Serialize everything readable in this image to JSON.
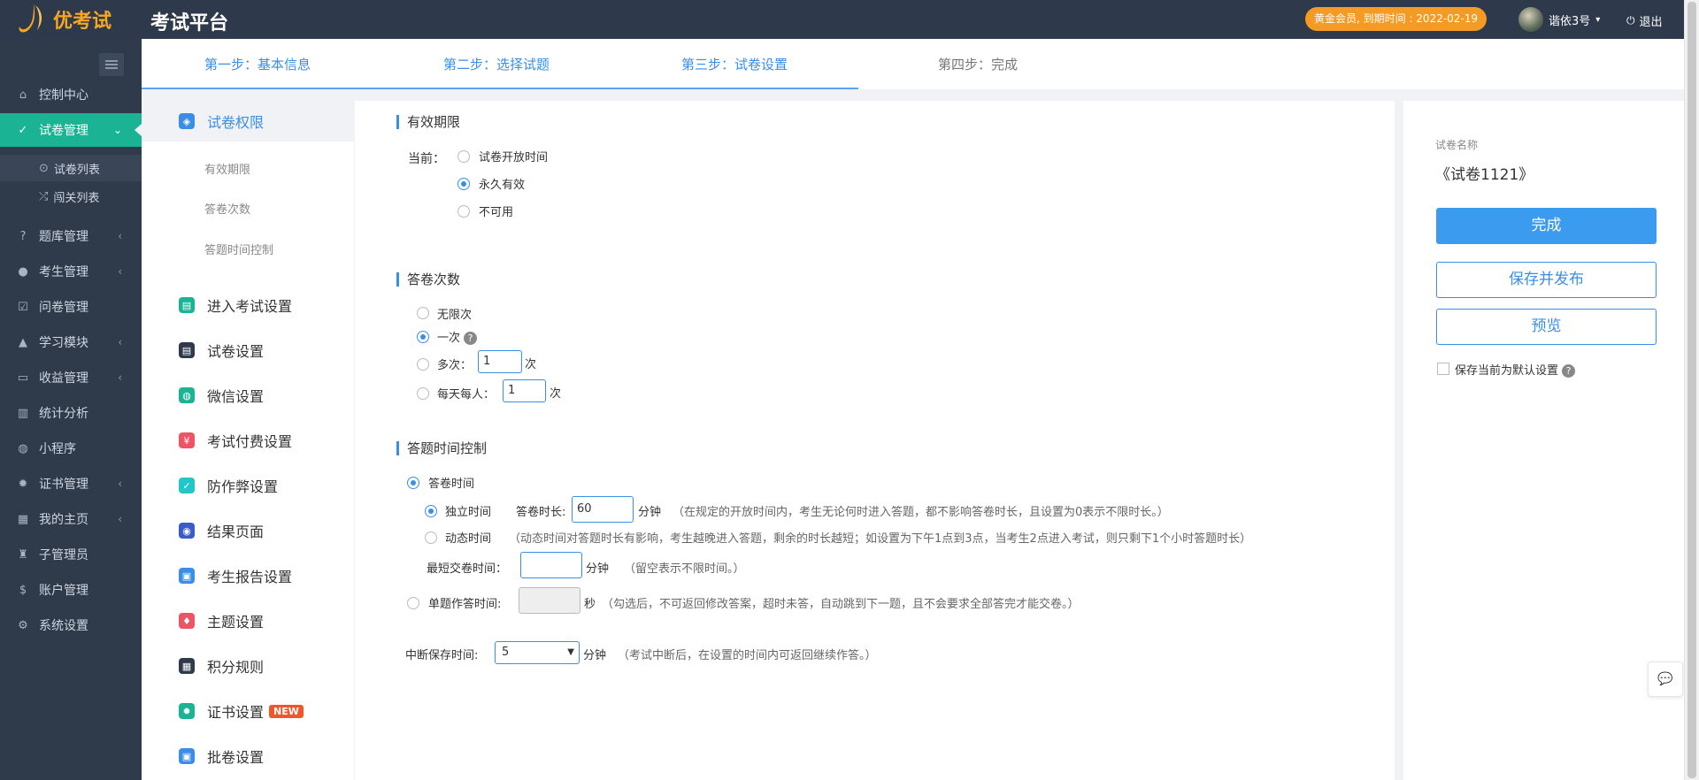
{
  "header": {
    "logo_text": "优考试",
    "title": "考试平台",
    "vip_text": "黄金会员, 到期时间 : 2022-02-19",
    "username": "谐依3号",
    "logout": "退出"
  },
  "sidebar": {
    "items": [
      {
        "label": "控制中心",
        "icon": "home-icon"
      },
      {
        "label": "试卷管理",
        "icon": "check-circle-icon"
      },
      {
        "label": "题库管理",
        "icon": "question-icon"
      },
      {
        "label": "考生管理",
        "icon": "user-icon"
      },
      {
        "label": "问卷管理",
        "icon": "check-square-icon"
      },
      {
        "label": "学习模块",
        "icon": "graduation-icon"
      },
      {
        "label": "收益管理",
        "icon": "money-icon"
      },
      {
        "label": "统计分析",
        "icon": "bar-chart-icon"
      },
      {
        "label": "小程序",
        "icon": "wechat-icon"
      },
      {
        "label": "证书管理",
        "icon": "certificate-icon"
      },
      {
        "label": "我的主页",
        "icon": "building-icon"
      },
      {
        "label": "子管理员",
        "icon": "user-lock-icon"
      },
      {
        "label": "账户管理",
        "icon": "dollar-icon"
      },
      {
        "label": "系统设置",
        "icon": "gear-icon"
      }
    ],
    "subitems": [
      {
        "label": "试卷列表"
      },
      {
        "label": "闯关列表"
      }
    ]
  },
  "steps": [
    "第一步：基本信息",
    "第二步：选择试题",
    "第三步：试卷设置",
    "第四步：完成"
  ],
  "leftnav": {
    "items": [
      {
        "label": "试卷权限",
        "color": "#3a8ee6"
      },
      {
        "label": "进入考试设置",
        "color": "#1ab394"
      },
      {
        "label": "试卷设置",
        "color": "#2f3a4b"
      },
      {
        "label": "微信设置",
        "color": "#1ab394"
      },
      {
        "label": "考试付费设置",
        "color": "#ed5565"
      },
      {
        "label": "防作弊设置",
        "color": "#23c6c8"
      },
      {
        "label": "结果页面",
        "color": "#3a5cc6"
      },
      {
        "label": "考生报告设置",
        "color": "#3a8ee6"
      },
      {
        "label": "主题设置",
        "color": "#ed5565"
      },
      {
        "label": "积分规则",
        "color": "#2f3a4b"
      },
      {
        "label": "证书设置",
        "color": "#1ab394"
      },
      {
        "label": "批卷设置",
        "color": "#3a8ee6"
      }
    ],
    "subs": [
      "有效期限",
      "答卷次数",
      "答题时间控制"
    ],
    "new_badge": "NEW"
  },
  "validity": {
    "title": "有效期限",
    "current_label": "当前：",
    "options": [
      "试卷开放时间",
      "永久有效",
      "不可用"
    ]
  },
  "attempts": {
    "title": "答卷次数",
    "unlimited": "无限次",
    "once": "一次",
    "multi": "多次：",
    "multi_value": "1",
    "unit": "次",
    "daily": "每天每人：",
    "daily_value": "1"
  },
  "timing": {
    "title": "答题时间控制",
    "answer_time": "答卷时间",
    "independent": "独立时间",
    "duration_label": "答卷时长:",
    "duration_value": "60",
    "minutes": "分钟",
    "independent_hint": "（在规定的开放时间内，考生无论何时进入答题，都不影响答卷时长，且设置为0表示不限时长。）",
    "dynamic": "动态时间",
    "dynamic_hint": "（动态时间对答题时长有影响，考生越晚进入答题，剩余的时长越短；如设置为下午1点到3点，当考生2点进入考试，则只剩下1个小时答题时长）",
    "min_submit": "最短交卷时间：",
    "min_submit_hint": "（留空表示不限时间。）",
    "single": "单题作答时间:",
    "seconds": "秒",
    "single_hint": "（勾选后，不可返回修改答案，超时未答，自动跳到下一题，且不会要求全部答完才能交卷。）",
    "interrupt": "中断保存时间:",
    "interrupt_value": "5",
    "interrupt_hint": "（考试中断后，在设置的时间内可返回继续作答。）"
  },
  "right": {
    "name_label": "试卷名称",
    "name_value": "《试卷1121》",
    "finish": "完成",
    "save_publish": "保存并发布",
    "preview": "预览",
    "default_label": "保存当前为默认设置"
  }
}
